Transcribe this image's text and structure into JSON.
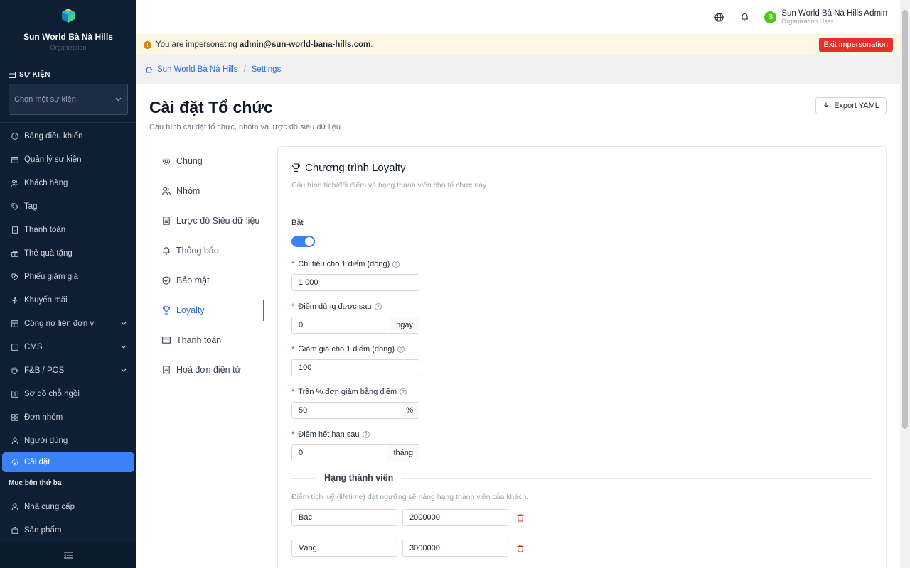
{
  "sidebar": {
    "org_name": "Sun World Bà Nà Hills",
    "org_sub": "Organization",
    "section_label": "SỰ KIỆN",
    "event_select_placeholder": "Chọn một sự kiện",
    "items": [
      {
        "label": "Bảng điều khiển",
        "icon": "dashboard-icon"
      },
      {
        "label": "Quản lý sự kiện",
        "icon": "calendar-icon"
      },
      {
        "label": "Khách hàng",
        "icon": "users-icon"
      },
      {
        "label": "Tag",
        "icon": "tag-icon"
      },
      {
        "label": "Thanh toán",
        "icon": "document-icon"
      },
      {
        "label": "Thẻ quà tặng",
        "icon": "gift-icon"
      },
      {
        "label": "Phiếu giảm giá",
        "icon": "coupon-icon"
      },
      {
        "label": "Khuyến mãi",
        "icon": "lightning-icon"
      },
      {
        "label": "Công nợ liên đơn vị",
        "icon": "ledger-icon"
      },
      {
        "label": "CMS",
        "icon": "cms-icon"
      },
      {
        "label": "F&B / POS",
        "icon": "coffee-icon"
      },
      {
        "label": "Sơ đồ chỗ ngồi",
        "icon": "seat-map-icon"
      },
      {
        "label": "Đơn nhóm",
        "icon": "grid-icon"
      },
      {
        "label": "Người dùng",
        "icon": "user-icon"
      },
      {
        "label": "Cài đặt",
        "icon": "gear-icon"
      }
    ],
    "third_party_label": "Mục bên thứ ba",
    "third_party_items": [
      {
        "label": "Nhà cung cấp",
        "icon": "user-icon"
      },
      {
        "label": "Sản phẩm",
        "icon": "bag-icon"
      }
    ]
  },
  "topbar": {
    "user_initial": "S",
    "user_name": "Sun World Bà Nà Hills Admin",
    "user_role": "Organization User"
  },
  "banner": {
    "prefix": "You are impersonating",
    "email": "admin@sun-world-bana-hills.com",
    "suffix": ".",
    "exit_label": "Exit impersonation"
  },
  "breadcrumb": {
    "home": "Sun World Bà Nà Hills",
    "current": "Settings"
  },
  "page": {
    "title": "Cài đặt Tổ chức",
    "subtitle": "Cấu hình cài đặt tổ chức, nhóm và lược đồ siêu dữ liệu",
    "export_label": "Export YAML"
  },
  "tabs": [
    {
      "label": "Chung",
      "icon": "gear-icon"
    },
    {
      "label": "Nhóm",
      "icon": "users-icon"
    },
    {
      "label": "Lược đồ Siêu dữ liệu",
      "icon": "list-icon"
    },
    {
      "label": "Thông báo",
      "icon": "bell-icon"
    },
    {
      "label": "Bảo mật",
      "icon": "shield-icon"
    },
    {
      "label": "Loyalty",
      "icon": "trophy-icon"
    },
    {
      "label": "Thanh toán",
      "icon": "card-icon"
    },
    {
      "label": "Hoá đơn điện tử",
      "icon": "receipt-icon"
    }
  ],
  "loyalty": {
    "title": "Chương trình Loyalty",
    "description": "Cấu hình tích/đổi điểm và hạng thành viên cho tổ chức này.",
    "enable_label": "Bật",
    "enabled": true,
    "spend_per_point_label": "Chi tiêu cho 1 điểm (đồng)",
    "spend_per_point_value": "1 000",
    "usable_after_label": "Điểm dùng được sau",
    "usable_after_value": "0",
    "usable_after_unit": "ngày",
    "discount_per_point_label": "Giảm giá cho 1 điểm (đồng)",
    "discount_per_point_value": "100",
    "max_percent_label": "Trần % đơn giảm bằng điểm",
    "max_percent_value": "50",
    "max_percent_unit": "%",
    "expire_after_label": "Điểm hết hạn sau",
    "expire_after_value": "0",
    "expire_after_unit": "tháng",
    "tiers_heading": "Hạng thành viên",
    "tiers_description": "Điểm tích luỹ (lifetime) đạt ngưỡng sẽ nâng hạng thành viên của khách.",
    "tiers": [
      {
        "name": "Bạc",
        "threshold": "2000000"
      },
      {
        "name": "Vàng",
        "threshold": "3000000"
      }
    ]
  },
  "colors": {
    "accent": "#3b82f6",
    "sidebar_bg": "#0f1f33",
    "danger": "#e5312b"
  }
}
